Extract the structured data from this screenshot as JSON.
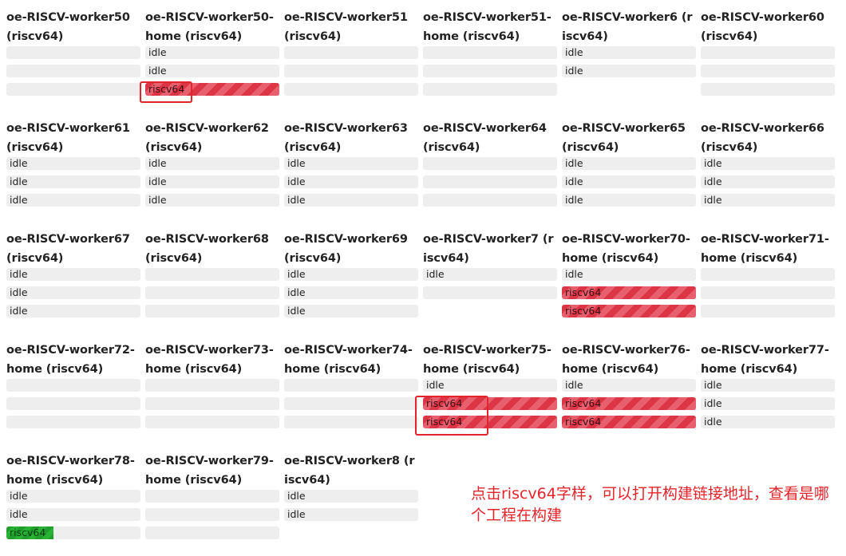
{
  "workers": [
    {
      "name": "oe-RISCV-worker50 (riscv64)",
      "bars": [
        {
          "label": "",
          "state": "empty"
        },
        {
          "label": "",
          "state": "empty"
        },
        {
          "label": "",
          "state": "empty"
        }
      ]
    },
    {
      "name": "oe-RISCV-worker50-home (riscv64)",
      "bars": [
        {
          "label": "idle",
          "state": "idle"
        },
        {
          "label": "idle",
          "state": "idle"
        },
        {
          "label": "riscv64",
          "state": "busy"
        }
      ]
    },
    {
      "name": "oe-RISCV-worker51 (riscv64)",
      "bars": [
        {
          "label": "",
          "state": "empty"
        },
        {
          "label": "",
          "state": "empty"
        },
        {
          "label": "",
          "state": "empty"
        }
      ]
    },
    {
      "name": "oe-RISCV-worker51-home (riscv64)",
      "bars": [
        {
          "label": "",
          "state": "empty"
        },
        {
          "label": "",
          "state": "empty"
        },
        {
          "label": "",
          "state": "empty"
        }
      ]
    },
    {
      "name": "oe-RISCV-worker6 (riscv64)",
      "bars": [
        {
          "label": "idle",
          "state": "idle"
        },
        {
          "label": "idle",
          "state": "idle"
        }
      ]
    },
    {
      "name": "oe-RISCV-worker60 (riscv64)",
      "bars": [
        {
          "label": "",
          "state": "empty"
        },
        {
          "label": "",
          "state": "empty"
        },
        {
          "label": "",
          "state": "empty"
        }
      ]
    },
    {
      "name": "oe-RISCV-worker61 (riscv64)",
      "bars": [
        {
          "label": "idle",
          "state": "idle"
        },
        {
          "label": "idle",
          "state": "idle"
        },
        {
          "label": "idle",
          "state": "idle"
        }
      ]
    },
    {
      "name": "oe-RISCV-worker62 (riscv64)",
      "bars": [
        {
          "label": "idle",
          "state": "idle"
        },
        {
          "label": "idle",
          "state": "idle"
        },
        {
          "label": "idle",
          "state": "idle"
        }
      ]
    },
    {
      "name": "oe-RISCV-worker63 (riscv64)",
      "bars": [
        {
          "label": "idle",
          "state": "idle"
        },
        {
          "label": "idle",
          "state": "idle"
        },
        {
          "label": "idle",
          "state": "idle"
        }
      ]
    },
    {
      "name": "oe-RISCV-worker64 (riscv64)",
      "bars": [
        {
          "label": "",
          "state": "empty"
        },
        {
          "label": "",
          "state": "empty"
        },
        {
          "label": "",
          "state": "empty"
        }
      ]
    },
    {
      "name": "oe-RISCV-worker65 (riscv64)",
      "bars": [
        {
          "label": "idle",
          "state": "idle"
        },
        {
          "label": "idle",
          "state": "idle"
        },
        {
          "label": "idle",
          "state": "idle"
        }
      ]
    },
    {
      "name": "oe-RISCV-worker66 (riscv64)",
      "bars": [
        {
          "label": "idle",
          "state": "idle"
        },
        {
          "label": "idle",
          "state": "idle"
        },
        {
          "label": "idle",
          "state": "idle"
        }
      ]
    },
    {
      "name": "oe-RISCV-worker67 (riscv64)",
      "bars": [
        {
          "label": "idle",
          "state": "idle"
        },
        {
          "label": "idle",
          "state": "idle"
        },
        {
          "label": "idle",
          "state": "idle"
        }
      ]
    },
    {
      "name": "oe-RISCV-worker68 (riscv64)",
      "bars": [
        {
          "label": "",
          "state": "empty"
        },
        {
          "label": "",
          "state": "empty"
        },
        {
          "label": "",
          "state": "empty"
        }
      ]
    },
    {
      "name": "oe-RISCV-worker69 (riscv64)",
      "bars": [
        {
          "label": "idle",
          "state": "idle"
        },
        {
          "label": "idle",
          "state": "idle"
        },
        {
          "label": "idle",
          "state": "idle"
        }
      ]
    },
    {
      "name": "oe-RISCV-worker7 (riscv64)",
      "bars": [
        {
          "label": "idle",
          "state": "idle"
        },
        {
          "label": "",
          "state": "empty"
        }
      ]
    },
    {
      "name": "oe-RISCV-worker70-home (riscv64)",
      "bars": [
        {
          "label": "idle",
          "state": "idle"
        },
        {
          "label": "riscv64",
          "state": "busy"
        },
        {
          "label": "riscv64",
          "state": "busy"
        }
      ]
    },
    {
      "name": "oe-RISCV-worker71-home (riscv64)",
      "bars": [
        {
          "label": "",
          "state": "empty"
        },
        {
          "label": "",
          "state": "empty"
        },
        {
          "label": "",
          "state": "empty"
        }
      ]
    },
    {
      "name": "oe-RISCV-worker72-home (riscv64)",
      "bars": [
        {
          "label": "",
          "state": "empty"
        },
        {
          "label": "",
          "state": "empty"
        },
        {
          "label": "",
          "state": "empty"
        }
      ]
    },
    {
      "name": "oe-RISCV-worker73-home (riscv64)",
      "bars": [
        {
          "label": "",
          "state": "empty"
        },
        {
          "label": "",
          "state": "empty"
        },
        {
          "label": "",
          "state": "empty"
        }
      ]
    },
    {
      "name": "oe-RISCV-worker74-home (riscv64)",
      "bars": [
        {
          "label": "",
          "state": "empty"
        },
        {
          "label": "",
          "state": "empty"
        },
        {
          "label": "",
          "state": "empty"
        }
      ]
    },
    {
      "name": "oe-RISCV-worker75-home (riscv64)",
      "bars": [
        {
          "label": "idle",
          "state": "idle"
        },
        {
          "label": "riscv64",
          "state": "busy"
        },
        {
          "label": "riscv64",
          "state": "busy"
        }
      ]
    },
    {
      "name": "oe-RISCV-worker76-home (riscv64)",
      "bars": [
        {
          "label": "idle",
          "state": "idle"
        },
        {
          "label": "riscv64",
          "state": "busy"
        },
        {
          "label": "riscv64",
          "state": "busy"
        }
      ]
    },
    {
      "name": "oe-RISCV-worker77-home (riscv64)",
      "bars": [
        {
          "label": "idle",
          "state": "idle"
        },
        {
          "label": "idle",
          "state": "idle"
        },
        {
          "label": "idle",
          "state": "idle"
        }
      ]
    },
    {
      "name": "oe-RISCV-worker78-home (riscv64)",
      "bars": [
        {
          "label": "idle",
          "state": "idle"
        },
        {
          "label": "idle",
          "state": "idle"
        },
        {
          "label": "riscv64",
          "state": "partial",
          "progress": 0.35
        }
      ]
    },
    {
      "name": "oe-RISCV-worker79-home (riscv64)",
      "bars": [
        {
          "label": "",
          "state": "empty"
        },
        {
          "label": "",
          "state": "empty"
        },
        {
          "label": "",
          "state": "empty"
        }
      ]
    },
    {
      "name": "oe-RISCV-worker8 (riscv64)",
      "bars": [
        {
          "label": "idle",
          "state": "idle"
        },
        {
          "label": "idle",
          "state": "idle"
        }
      ]
    }
  ],
  "annotation": {
    "note": "点击riscv64字样，可以打开构建链接地址，查看是哪个工程在构建",
    "color": "#e3242b"
  },
  "colors": {
    "busy": "#dc3545",
    "progress": "#1f9e2c",
    "idle_bg": "#eeeeee"
  }
}
